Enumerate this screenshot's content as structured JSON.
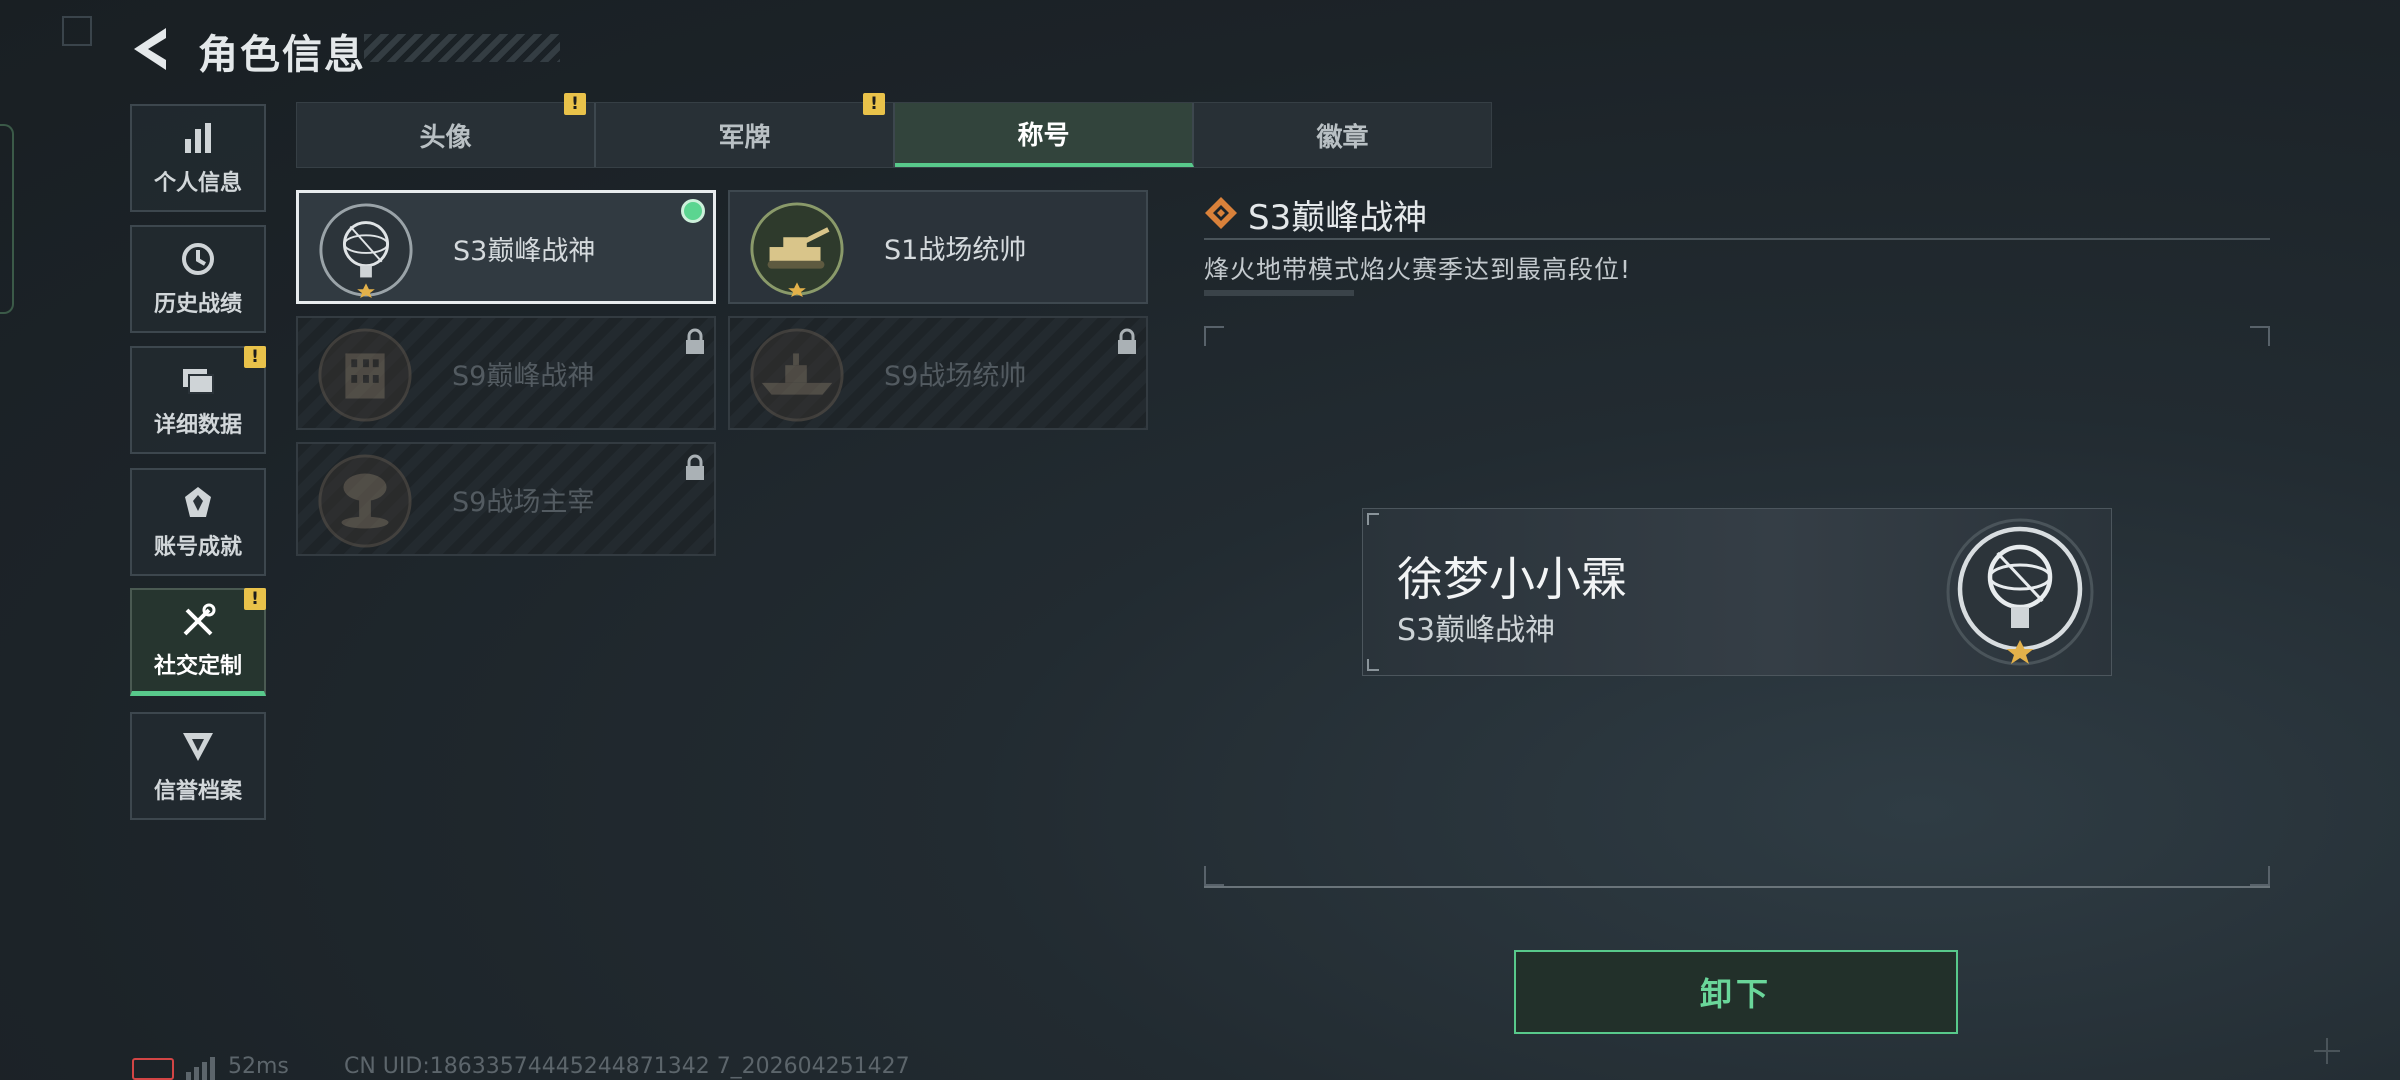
{
  "header": {
    "title": "角色信息"
  },
  "sidebar": {
    "items": [
      {
        "label": "个人信息",
        "icon": "bar-chart-icon",
        "active": false,
        "warning": false
      },
      {
        "label": "历史战绩",
        "icon": "history-clock-icon",
        "active": false,
        "warning": false
      },
      {
        "label": "详细数据",
        "icon": "folder-icon",
        "active": false,
        "warning": true
      },
      {
        "label": "账号成就",
        "icon": "achievement-icon",
        "active": false,
        "warning": false
      },
      {
        "label": "社交定制",
        "icon": "tools-icon",
        "active": true,
        "warning": true
      },
      {
        "label": "信誉档案",
        "icon": "reputation-icon",
        "active": false,
        "warning": false
      }
    ],
    "warning_mark": "!"
  },
  "tabs": [
    {
      "label": "头像",
      "warning": true,
      "active": false
    },
    {
      "label": "军牌",
      "warning": true,
      "active": false
    },
    {
      "label": "称号",
      "warning": false,
      "active": true
    },
    {
      "label": "徽章",
      "warning": false,
      "active": false
    }
  ],
  "titles": [
    {
      "name": "S3巅峰战神",
      "locked": false,
      "selected": true,
      "equipped": true,
      "emblem": "armillary-emblem"
    },
    {
      "name": "S1战场统帅",
      "locked": false,
      "selected": false,
      "equipped": false,
      "emblem": "tank-emblem"
    },
    {
      "name": "S9巅峰战神",
      "locked": true,
      "selected": false,
      "equipped": false,
      "emblem": "building-emblem"
    },
    {
      "name": "S9战场统帅",
      "locked": true,
      "selected": false,
      "equipped": false,
      "emblem": "warship-emblem"
    },
    {
      "name": "S9战场主宰",
      "locked": true,
      "selected": false,
      "equipped": false,
      "emblem": "mushroom-cloud-emblem"
    }
  ],
  "detail": {
    "title": "S3巅峰战神",
    "description": "烽火地带模式焰火赛季达到最高段位!"
  },
  "nameplate": {
    "player_name": "徐梦小小霖",
    "title": "S3巅峰战神"
  },
  "actions": {
    "unequip_label": "卸下"
  },
  "status": {
    "ping": "52ms",
    "uid": "CN UID:18633574445244871342 7_202604251427"
  },
  "colors": {
    "accent": "#58c98b",
    "warning": "#e9c24a",
    "battery": "#d24545"
  }
}
